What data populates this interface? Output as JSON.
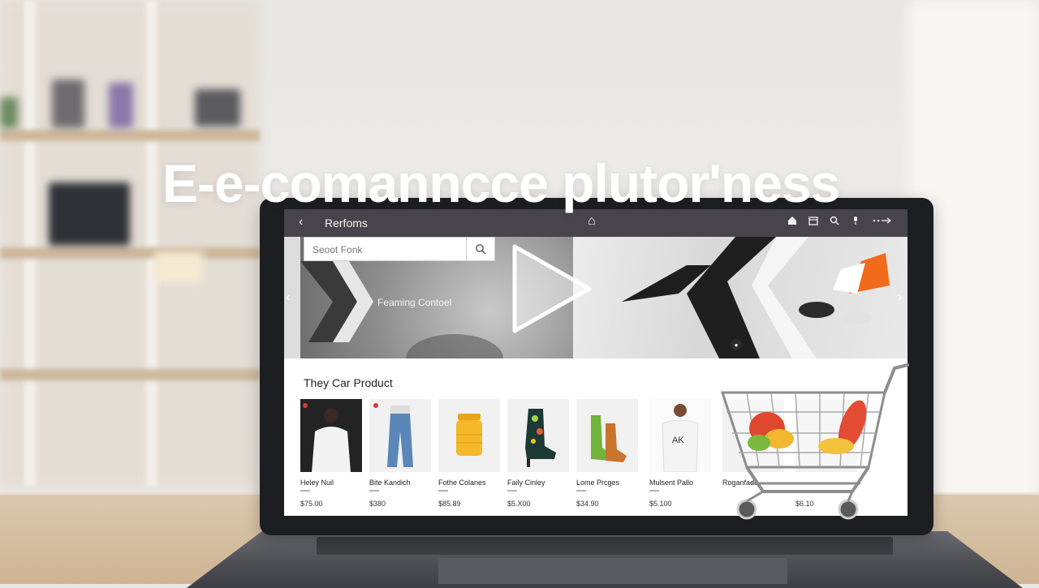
{
  "hero": {
    "title": "E-e-comanncce plutor'ness"
  },
  "topbar": {
    "back_glyph": "‹",
    "title": "Rerfoms",
    "home_glyph": "⌂",
    "icons": [
      "home-icon",
      "calendar-icon",
      "search-icon",
      "mic-icon",
      "share-icon"
    ]
  },
  "search": {
    "placeholder": "Seoot Fonk"
  },
  "banner": {
    "caption": "Feaming Contoel"
  },
  "section": {
    "title": "They Car Product"
  },
  "products": [
    {
      "name": "Heley Nuil",
      "price": "$75.00"
    },
    {
      "name": "Bite Kandich",
      "price": "$380"
    },
    {
      "name": "Fothe Colanes",
      "price": "$85.89"
    },
    {
      "name": "Faily Cinley",
      "price": "$5.X00"
    },
    {
      "name": "Lome Prcges",
      "price": "$34.90"
    },
    {
      "name": "Mulsent Pallo",
      "price": "$5.100"
    },
    {
      "name": "Roganfade",
      "price": ""
    },
    {
      "name": "",
      "price": "$6.10"
    }
  ],
  "colors": {
    "topbar": "#47454b",
    "accent_orange": "#f26a1b",
    "screen_bg": "#ffffff"
  }
}
